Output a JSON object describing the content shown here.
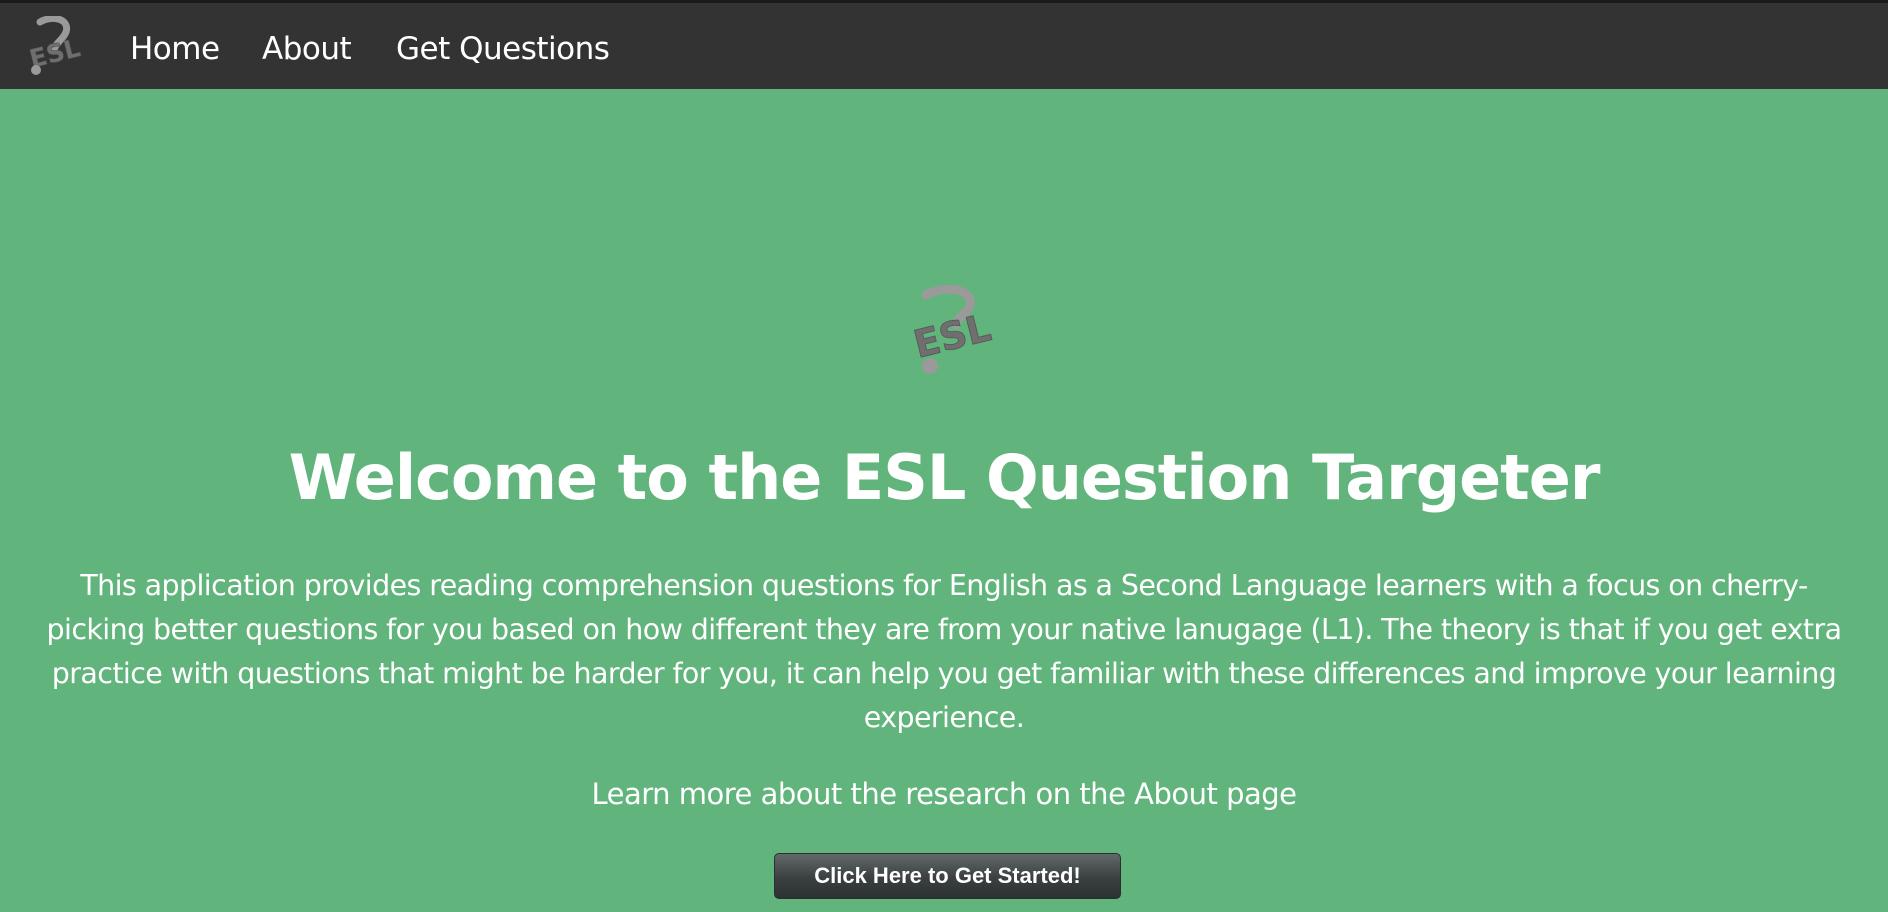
{
  "nav": {
    "logo_icon": "esl-question-mark-logo-icon",
    "items": [
      {
        "label": "Home"
      },
      {
        "label": "About"
      },
      {
        "label": "Get Questions"
      }
    ]
  },
  "hero": {
    "logo_icon": "esl-question-mark-logo-icon",
    "logo_text": "ESL",
    "title": "Welcome to the ESL Question Targeter",
    "description": "This application provides reading comprehension questions for English as a Second Language learners with a focus on cherry-picking better questions for you based on how different they are from your native lanugage (L1). The theory is that if you get extra practice with questions that might be harder for you, it can help you get familiar with these differences and improve your learning experience.",
    "learn_more": "Learn more about the research on the About page",
    "cta_label": "Click Here to Get Started!"
  },
  "colors": {
    "background": "#61b47b",
    "navbar": "#333333",
    "text": "#ffffff",
    "logo_gray": "#7a7a7a",
    "button": "#3a4040"
  }
}
